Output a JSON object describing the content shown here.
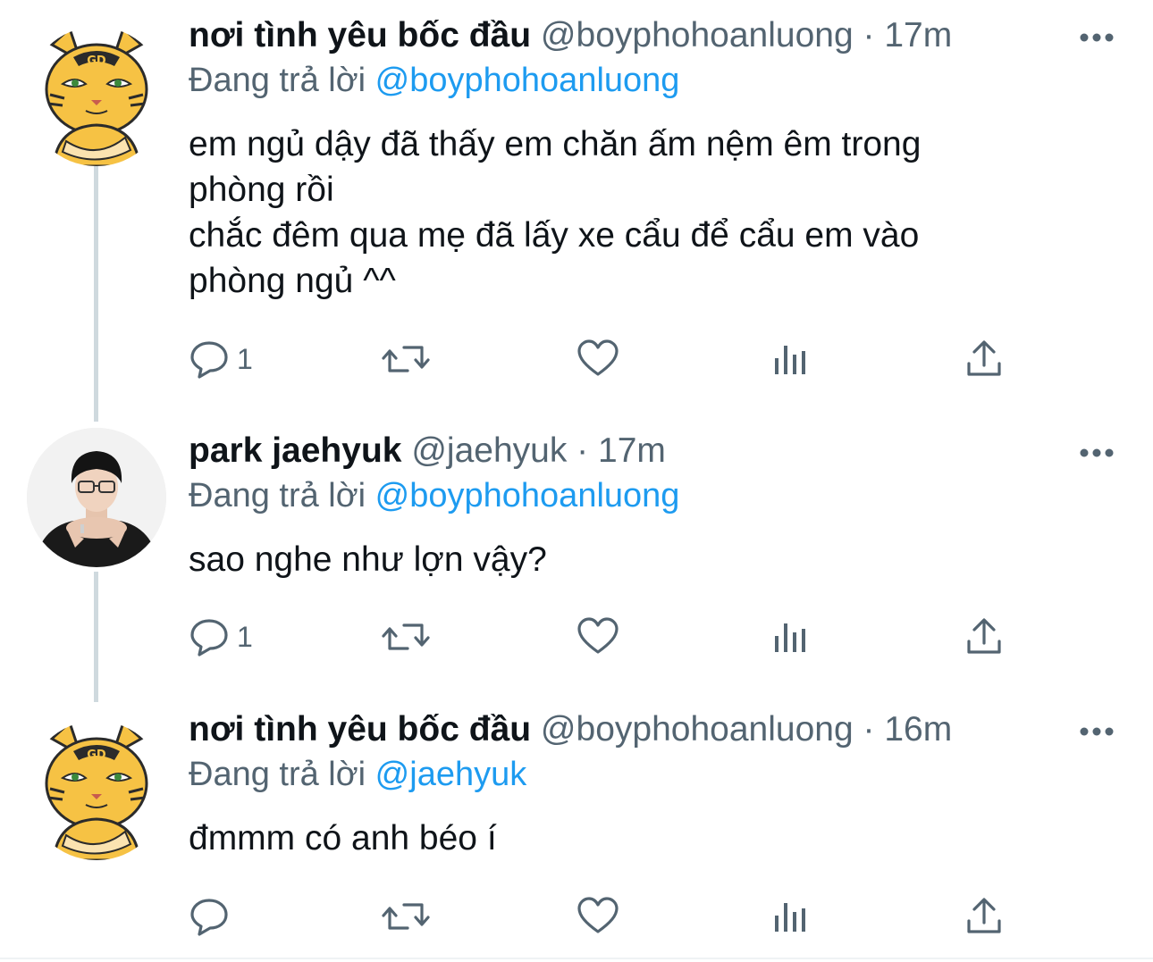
{
  "tweets": [
    {
      "display_name": "nơi tình yêu bốc đầu",
      "handle": "@boyphohoanluong",
      "separator": "·",
      "time": "17m",
      "replying_prefix": "Đang trả lời",
      "replying_to": "@boyphohoanluong",
      "text_lines": [
        "em ngủ dậy đã thấy em chăn ấm nệm êm trong",
        "phòng rồi",
        "chắc đêm qua mẹ đã lấy xe cẩu để cẩu em vào",
        "phòng ngủ ^^"
      ],
      "reply_count": "1",
      "avatar_icon": "tiger-cartoon-avatar"
    },
    {
      "display_name": "park jaehyuk",
      "handle": "@jaehyuk",
      "separator": "·",
      "time": "17m",
      "replying_prefix": "Đang trả lời",
      "replying_to": "@boyphohoanluong",
      "text_lines": [
        "sao nghe như lợn vậy?"
      ],
      "reply_count": "1",
      "avatar_icon": "person-photo-avatar"
    },
    {
      "display_name": "nơi tình yêu bốc đầu",
      "handle": "@boyphohoanluong",
      "separator": "·",
      "time": "16m",
      "replying_prefix": "Đang trả lời",
      "replying_to": "@jaehyuk",
      "text_lines": [
        "đmmm có anh béo í"
      ],
      "reply_count": "",
      "avatar_icon": "tiger-cartoon-avatar"
    }
  ],
  "colors": {
    "text": "#0f1419",
    "secondary": "#536471",
    "accent": "#1d9bf0",
    "thread_line": "#cfd9de"
  },
  "icons": [
    "reply-icon",
    "retweet-icon",
    "like-icon",
    "analytics-icon",
    "share-icon",
    "more-icon"
  ]
}
